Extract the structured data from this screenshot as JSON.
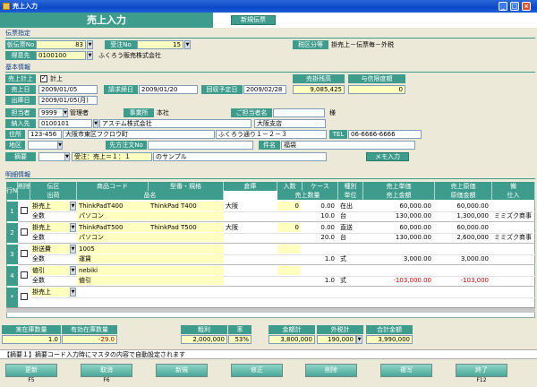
{
  "window": {
    "title": "売上入力",
    "min": "_",
    "max": "□",
    "close": "×"
  },
  "app": {
    "title": "売上入力",
    "new_slip": "新規伝票"
  },
  "slip": {
    "section": "伝票指定",
    "temp_no_label": "仮伝票No",
    "temp_no": "83",
    "order_no_label": "受注No",
    "order_no": "15",
    "tax_label": "税区分等",
    "tax_value": "掛売上－伝票毎－外税",
    "customer_label": "得意先",
    "customer_code": "0100100",
    "customer_name": "ふくろう販売株式会社"
  },
  "basic": {
    "section": "基本情報",
    "posting_label": "売上計上",
    "posting_check": "計上",
    "balance_label": "売掛残高",
    "credit_label": "与信限度額",
    "balance": "9,085,425",
    "credit": "0",
    "sales_date_label": "売上日",
    "sales_date": "2009/01/05",
    "close_label": "請求締日",
    "close_date": "2009/01/20",
    "collect_label": "回収予定日",
    "collect_date": "2009/02/28",
    "ship_label": "出庫日",
    "ship_date": "2009/01/05(月)",
    "staff_label": "担当者",
    "staff_code": "9999",
    "staff_name": "管理者",
    "office_label": "事業所",
    "office": "本社",
    "attn_label": "ご担当者名",
    "attn": "",
    "sama": "様",
    "dest_label": "納入先",
    "dest_code": "0100101",
    "dest_name": "アステム株式会社",
    "dest_branch": "大阪支店",
    "addr_label": "住所",
    "zip": "123-456",
    "addr1": "大阪市東区フクロウ町",
    "addr2": "ふくろう通り１－２－３",
    "tel_label": "TEL",
    "tel": "06-6666-6666",
    "area_label": "地区",
    "po_label": "先方注文No",
    "subject_label": "件名",
    "subject": "福袋",
    "summary_label": "摘要",
    "summary": "受注：売上＝１：１",
    "summary_suffix": "のサンプル",
    "memo": "メモ入力"
  },
  "detail": {
    "section": "明細情報",
    "head1": [
      "行No",
      "削除",
      "伝区",
      "商品コード",
      "型番・規格",
      "倉庫",
      "入数",
      "ケース",
      "種別",
      "売上単価",
      "売上原価",
      "備"
    ],
    "head2": [
      "出荷",
      "品名",
      "売上数量",
      "単位",
      "売上金額",
      "原価金額",
      "仕入"
    ],
    "rows": [
      {
        "no": "1",
        "kind": "掛売上",
        "code": "ThinkPadT400",
        "model": "ThinkPad T400",
        "wh": "大阪",
        "qty_in": "0",
        "case": "0.00",
        "type": "在出",
        "price": "60,000.00",
        "cost": "60,000.00",
        "ship": "全数",
        "name": "パソコン",
        "qty": "10.0",
        "unit": "台",
        "amount": "130,000.00",
        "camount": "1,300,000",
        "supp": "ミミズク商事"
      },
      {
        "no": "2",
        "kind": "掛売上",
        "code": "ThinkPadT500",
        "model": "ThinkPad T500",
        "wh": "大阪",
        "qty_in": "0",
        "case": "0.00",
        "type": "直送",
        "price": "60,000.00",
        "cost": "60,000.00",
        "ship": "全数",
        "name": "パソコン",
        "qty": "20.0",
        "unit": "台",
        "amount": "130,000.00",
        "camount": "2,600,000",
        "supp": "ミミズク商事"
      },
      {
        "no": "3",
        "kind": "掛送費",
        "code": "1005",
        "model": "",
        "wh": "",
        "qty_in": "",
        "case": "",
        "type": "",
        "price": "",
        "cost": "",
        "ship": "全数",
        "name": "運賃",
        "qty": "1.0",
        "unit": "式",
        "amount": "3,000.00",
        "camount": "3,000.00",
        "supp": ""
      },
      {
        "no": "4",
        "kind": "値引",
        "code": "nebiki",
        "model": "",
        "wh": "",
        "qty_in": "",
        "case": "",
        "type": "",
        "price": "",
        "cost": "",
        "ship": "全数",
        "name": "値引",
        "qty": "1.0",
        "unit": "式",
        "amount": "-103,000.00",
        "camount": "-103,000",
        "supp": ""
      },
      {
        "no": "*",
        "kind": "掛売上",
        "code": "",
        "model": "",
        "wh": "",
        "qty_in": "",
        "case": "",
        "type": "",
        "price": "",
        "cost": "",
        "ship": "",
        "name": "",
        "qty": "",
        "unit": "",
        "amount": "",
        "camount": "",
        "supp": ""
      }
    ]
  },
  "totals": {
    "stock_label": "実在庫数量",
    "stock": "1.0",
    "avail_label": "有効在庫数量",
    "avail": "-29.0",
    "gross_label": "粗利",
    "gross": "2,000,000",
    "rate_label": "率",
    "rate": "53%",
    "sum_label": "金額計",
    "sum": "3,800,000",
    "tax_label": "外税計",
    "tax": "190,000",
    "total_label": "合計金額",
    "total": "3,990,000"
  },
  "message": "【摘要１】摘要コード入力時にマスタの内容で自動設定されます",
  "fkeys": [
    {
      "label": "更新",
      "key": "F5"
    },
    {
      "label": "取消",
      "key": "F6"
    },
    {
      "label": "新規",
      "key": ""
    },
    {
      "label": "修正",
      "key": ""
    },
    {
      "label": "削除",
      "key": ""
    },
    {
      "label": "複写",
      "key": ""
    },
    {
      "label": "終了",
      "key": "F12"
    }
  ]
}
